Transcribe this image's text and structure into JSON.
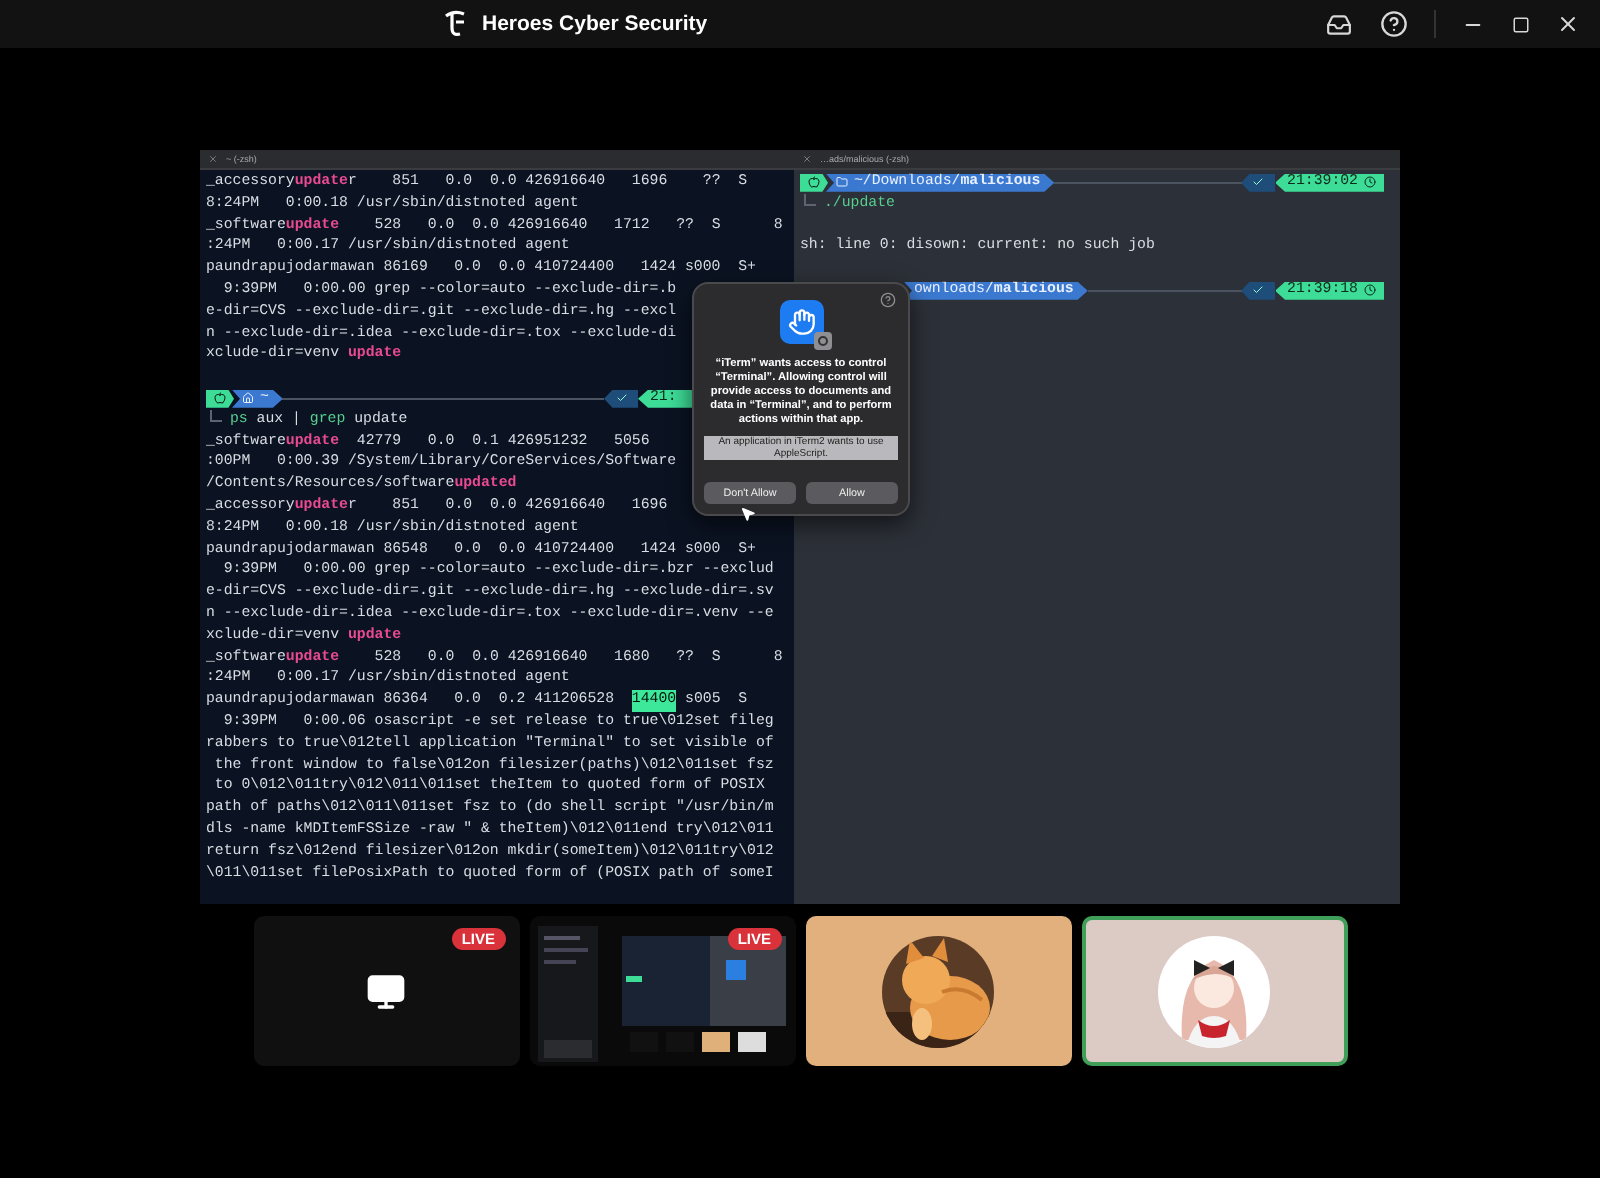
{
  "app_bar": {
    "title": "Heroes Cyber Security"
  },
  "shared_screen": {
    "left_terminal": {
      "tab_title": "~ (-zsh)",
      "lines": [
        {
          "kind": "text",
          "segments": [
            {
              "text": "_accessory",
              "kind": "plain"
            },
            {
              "text": "update",
              "kind": "match"
            },
            {
              "text": "r    851   0.0  0.0 426916640   1696    ??  S",
              "kind": "plain"
            }
          ]
        },
        {
          "kind": "text",
          "segments": [
            {
              "text": "8:24PM   0:00.18 /usr/sbin/distnoted agent",
              "kind": "plain"
            }
          ]
        },
        {
          "kind": "text",
          "segments": [
            {
              "text": "_software",
              "kind": "plain"
            },
            {
              "text": "update",
              "kind": "match"
            },
            {
              "text": "    528   0.0  0.0 426916640   1712   ??  S      8",
              "kind": "plain"
            }
          ]
        },
        {
          "kind": "text",
          "segments": [
            {
              "text": ":24PM   0:00.17 /usr/sbin/distnoted agent",
              "kind": "plain"
            }
          ]
        },
        {
          "kind": "text",
          "segments": [
            {
              "text": "paundrapujodarmawan 86169   0.0  0.0 410724400   1424 s000  S+",
              "kind": "plain"
            }
          ]
        },
        {
          "kind": "text",
          "segments": [
            {
              "text": "  9:39PM   0:00.00 grep --color=auto --exclude-dir=.b",
              "kind": "plain"
            }
          ]
        },
        {
          "kind": "text",
          "segments": [
            {
              "text": "e-dir=CVS --exclude-dir=.git --exclude-dir=.hg --excl",
              "kind": "plain"
            }
          ]
        },
        {
          "kind": "text",
          "segments": [
            {
              "text": "n --exclude-dir=.idea --exclude-dir=.tox --exclude-di",
              "kind": "plain"
            }
          ]
        },
        {
          "kind": "text",
          "segments": [
            {
              "text": "xclude-dir=venv ",
              "kind": "plain"
            },
            {
              "text": "update",
              "kind": "match"
            }
          ]
        },
        {
          "kind": "blank"
        },
        {
          "kind": "prompt",
          "path": {
            "kind": "home",
            "text": "~"
          },
          "time": {
            "kind": "clipped",
            "text": "21:"
          }
        },
        {
          "kind": "command",
          "segments": [
            {
              "text": "ps",
              "kind": "command"
            },
            {
              "text": " aux | ",
              "kind": "plain"
            },
            {
              "text": "grep",
              "kind": "command"
            },
            {
              "text": " update",
              "kind": "plain"
            }
          ]
        },
        {
          "kind": "text",
          "segments": [
            {
              "text": "_software",
              "kind": "plain"
            },
            {
              "text": "update",
              "kind": "match"
            },
            {
              "text": "  42779   0.0  0.1 426951232   5056",
              "kind": "plain"
            }
          ]
        },
        {
          "kind": "text",
          "segments": [
            {
              "text": ":00PM   0:00.39 /System/Library/CoreServices/Software",
              "kind": "plain"
            }
          ]
        },
        {
          "kind": "text",
          "segments": [
            {
              "text": "/Contents/Resources/software",
              "kind": "plain"
            },
            {
              "text": "updated",
              "kind": "match"
            }
          ]
        },
        {
          "kind": "text",
          "segments": [
            {
              "text": "_accessory",
              "kind": "plain"
            },
            {
              "text": "update",
              "kind": "match"
            },
            {
              "text": "r    851   0.0  0.0 426916640   1696",
              "kind": "plain"
            }
          ]
        },
        {
          "kind": "text",
          "segments": [
            {
              "text": "8:24PM   0:00.18 /usr/sbin/distnoted agent",
              "kind": "plain"
            }
          ]
        },
        {
          "kind": "text",
          "segments": [
            {
              "text": "paundrapujodarmawan 86548   0.0  0.0 410724400   1424 s000  S+",
              "kind": "plain"
            }
          ]
        },
        {
          "kind": "text",
          "segments": [
            {
              "text": "  9:39PM   0:00.00 grep --color=auto --exclude-dir=.bzr --exclud",
              "kind": "plain"
            }
          ]
        },
        {
          "kind": "text",
          "segments": [
            {
              "text": "e-dir=CVS --exclude-dir=.git --exclude-dir=.hg --exclude-dir=.sv",
              "kind": "plain"
            }
          ]
        },
        {
          "kind": "text",
          "segments": [
            {
              "text": "n --exclude-dir=.idea --exclude-dir=.tox --exclude-dir=.venv --e",
              "kind": "plain"
            }
          ]
        },
        {
          "kind": "text",
          "segments": [
            {
              "text": "xclude-dir=venv ",
              "kind": "plain"
            },
            {
              "text": "update",
              "kind": "match"
            }
          ]
        },
        {
          "kind": "text",
          "segments": [
            {
              "text": "_software",
              "kind": "plain"
            },
            {
              "text": "update",
              "kind": "match"
            },
            {
              "text": "    528   0.0  0.0 426916640   1680   ??  S      8",
              "kind": "plain"
            }
          ]
        },
        {
          "kind": "text",
          "segments": [
            {
              "text": ":24PM   0:00.17 /usr/sbin/distnoted agent",
              "kind": "plain"
            }
          ]
        },
        {
          "kind": "text",
          "segments": [
            {
              "text": "paundrapujodarmawan 86364   0.0  0.2 411206528  ",
              "kind": "plain"
            },
            {
              "text": "14400",
              "kind": "hit"
            },
            {
              "text": " s005  S",
              "kind": "plain"
            }
          ]
        },
        {
          "kind": "text",
          "segments": [
            {
              "text": "  9:39PM   0:00.06 osascript -e set release to true\\012set fileg",
              "kind": "plain"
            }
          ]
        },
        {
          "kind": "text",
          "segments": [
            {
              "text": "rabbers to true\\012tell application \"Terminal\" to set visible of",
              "kind": "plain"
            }
          ]
        },
        {
          "kind": "text",
          "segments": [
            {
              "text": " the front window to false\\012on filesizer(paths)\\012\\011set fsz",
              "kind": "plain"
            }
          ]
        },
        {
          "kind": "text",
          "segments": [
            {
              "text": " to 0\\012\\011try\\012\\011\\011set theItem to quoted form of POSIX",
              "kind": "plain"
            }
          ]
        },
        {
          "kind": "text",
          "segments": [
            {
              "text": "path of paths\\012\\011\\011set fsz to (do shell script \"/usr/bin/m",
              "kind": "plain"
            }
          ]
        },
        {
          "kind": "text",
          "segments": [
            {
              "text": "dls -name kMDItemFSSize -raw \" & theItem)\\012\\011end try\\012\\011",
              "kind": "plain"
            }
          ]
        },
        {
          "kind": "text",
          "segments": [
            {
              "text": "return fsz\\012end filesizer\\012on mkdir(someItem)\\012\\011try\\012",
              "kind": "plain"
            }
          ]
        },
        {
          "kind": "text",
          "segments": [
            {
              "text": "\\011\\011set filePosixPath to quoted form of (POSIX path of someI",
              "kind": "plain"
            }
          ]
        }
      ]
    },
    "right_terminal": {
      "tab_title": "…ads/malicious (-zsh)",
      "lines": [
        {
          "kind": "prompt",
          "path": {
            "kind": "folder",
            "text": "~/Downloads/**malicious**"
          },
          "time": {
            "kind": "full",
            "text": "21:39:02"
          }
        },
        {
          "kind": "command",
          "segments": [
            {
              "text": "./update",
              "kind": "command"
            }
          ]
        },
        {
          "kind": "blank"
        },
        {
          "kind": "text",
          "segments": [
            {
              "text": "sh: line 0: disown: current: no such job",
              "kind": "plain"
            }
          ]
        },
        {
          "kind": "blank"
        },
        {
          "kind": "prompt",
          "path": {
            "kind": "partial",
            "text": "ownloads/**malicious**"
          },
          "time": {
            "kind": "full",
            "text": "21:39:18"
          }
        }
      ]
    },
    "dialog": {
      "message": "“iTerm” wants access to control “Terminal”. Allowing control will provide access to documents and data in “Terminal”, and to perform actions within that app.",
      "detail": "An application in iTerm2 wants to use AppleScript.",
      "buttons": [
        "Don't Allow",
        "Allow"
      ]
    }
  },
  "participants": [
    {
      "kind": "screen",
      "badge": "LIVE",
      "speaking": false
    },
    {
      "kind": "picture",
      "badge": "LIVE",
      "speaking": false
    },
    {
      "kind": "avatar",
      "speaking": false
    },
    {
      "kind": "avatar",
      "speaking": true
    }
  ]
}
